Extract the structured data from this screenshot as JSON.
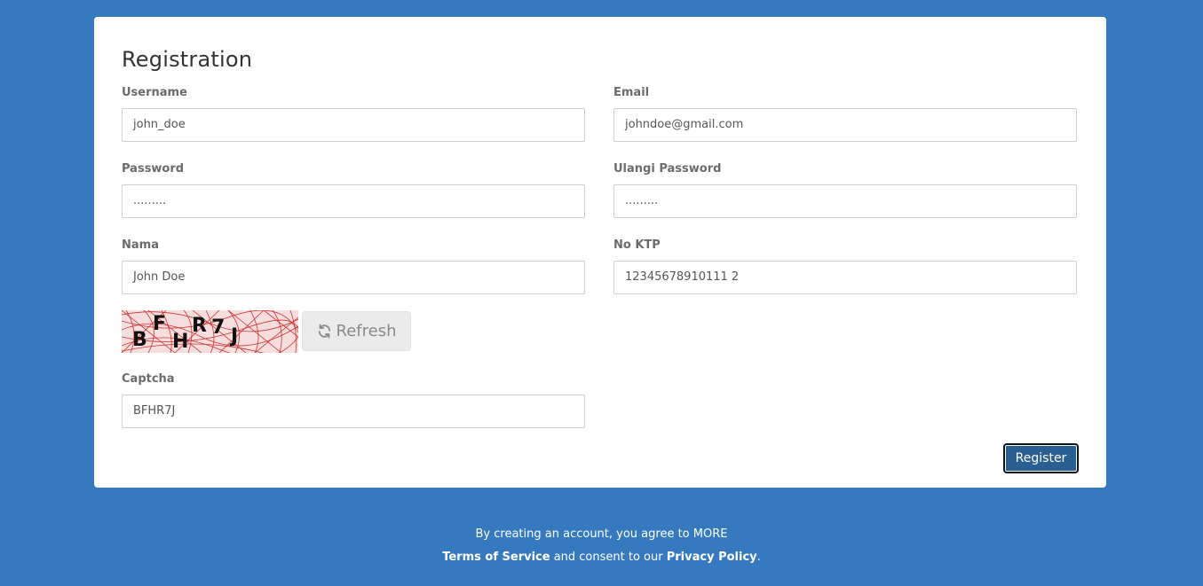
{
  "form": {
    "title": "Registration",
    "username_label": "Username",
    "username_value": "john_doe",
    "email_label": "Email",
    "email_value": "johndoe@gmail.com",
    "password_label": "Password",
    "password_value": ".........",
    "confirm_password_label": "Ulangi Password",
    "confirm_password_value": ".........",
    "name_label": "Nama",
    "name_value": "John Doe",
    "ktp_label": "No KTP",
    "ktp_value": "12345678910111 2",
    "captcha_text": "BFHR7J",
    "refresh_label": "Refresh",
    "captcha_label": "Captcha",
    "captcha_value": "BFHR7J",
    "register_label": "Register"
  },
  "footer": {
    "line1": "By creating an account, you agree to MORE",
    "terms": "Terms of Service",
    "middle": " and consent to our ",
    "privacy": "Privacy Policy",
    "end": "."
  },
  "colors": {
    "background": "#357abf",
    "card": "#ffffff",
    "register_button": "#2a5f94",
    "captcha_lines": "#cc1f1f"
  },
  "icons": {
    "refresh": "refresh-icon"
  }
}
